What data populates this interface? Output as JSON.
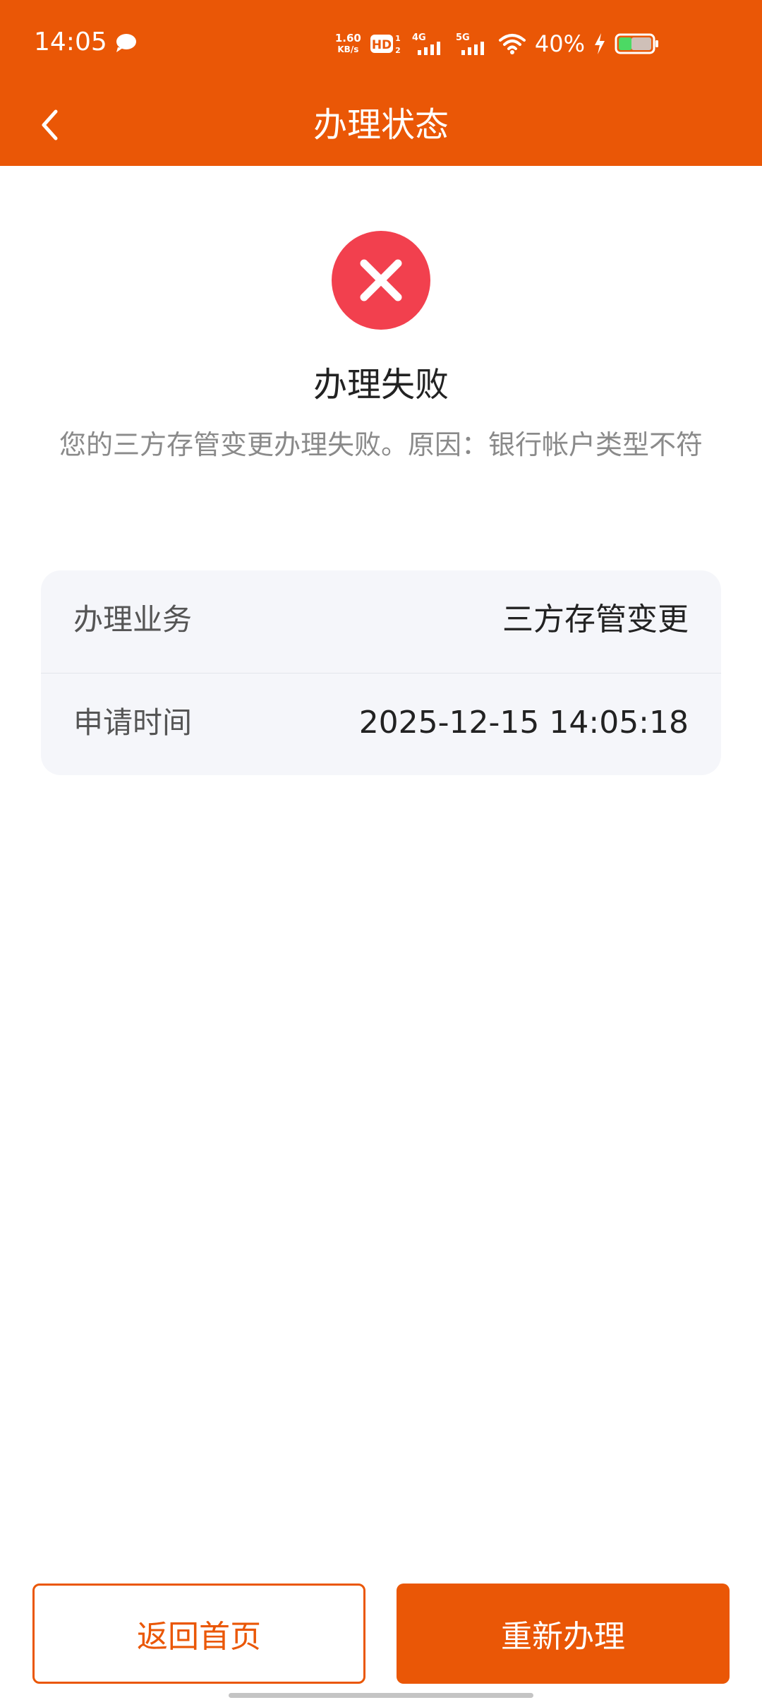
{
  "status_bar": {
    "time": "14:05",
    "net_speed_value": "1.60",
    "net_speed_unit": "KB/s",
    "hd_label": "HD",
    "signal_4g": "4G",
    "signal_5g": "5G",
    "battery_percent": "40%",
    "battery_level": 0.4
  },
  "nav": {
    "title": "办理状态"
  },
  "result": {
    "title": "办理失败",
    "description": "您的三方存管变更办理失败。原因：银行帐户类型不符",
    "status_color": "#F2404E"
  },
  "info": {
    "rows": [
      {
        "label": "办理业务",
        "value": "三方存管变更"
      },
      {
        "label": "申请时间",
        "value": "2025-12-15 14:05:18"
      }
    ]
  },
  "buttons": {
    "home_label": "返回首页",
    "retry_label": "重新办理"
  },
  "theme": {
    "accent": "#EA5706"
  }
}
